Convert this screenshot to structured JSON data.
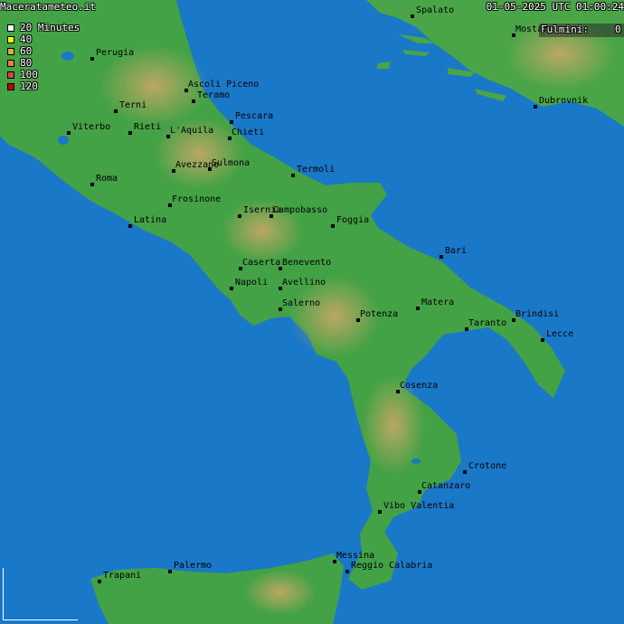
{
  "header": {
    "site": "Maceratameteo.it",
    "timestamp": "01-05-2025 UTC 01:00:24",
    "fulmini_label": "Fulmini:",
    "fulmini_count": "0"
  },
  "legend": [
    {
      "label": "20 Minutes",
      "color": "#ffffff"
    },
    {
      "label": "40",
      "color": "#ffff00"
    },
    {
      "label": "60",
      "color": "#e0b020"
    },
    {
      "label": "80",
      "color": "#e08040"
    },
    {
      "label": "100",
      "color": "#e04040"
    },
    {
      "label": "120",
      "color": "#c00000"
    }
  ],
  "cities": [
    {
      "name": "Spalato"
    },
    {
      "name": "Mostar"
    },
    {
      "name": "Dubrovnik"
    },
    {
      "name": "Perugia"
    },
    {
      "name": "Ascoli Piceno"
    },
    {
      "name": "Teramo"
    },
    {
      "name": "Terni"
    },
    {
      "name": "Pescara"
    },
    {
      "name": "Viterbo"
    },
    {
      "name": "Rieti"
    },
    {
      "name": "L'Aquila"
    },
    {
      "name": "Chieti"
    },
    {
      "name": "Sulmona"
    },
    {
      "name": "Avezzano"
    },
    {
      "name": "Termoli"
    },
    {
      "name": "Roma"
    },
    {
      "name": "Frosinone"
    },
    {
      "name": "Isernia"
    },
    {
      "name": "Campobasso"
    },
    {
      "name": "Foggia"
    },
    {
      "name": "Latina"
    },
    {
      "name": "Bari"
    },
    {
      "name": "Caserta"
    },
    {
      "name": "Benevento"
    },
    {
      "name": "Napoli"
    },
    {
      "name": "Avellino"
    },
    {
      "name": "Salerno"
    },
    {
      "name": "Matera"
    },
    {
      "name": "Brindisi"
    },
    {
      "name": "Potenza"
    },
    {
      "name": "Taranto"
    },
    {
      "name": "Lecce"
    },
    {
      "name": "Cosenza"
    },
    {
      "name": "Crotone"
    },
    {
      "name": "Catanzaro"
    },
    {
      "name": "Vibo Valentia"
    },
    {
      "name": "Messina"
    },
    {
      "name": "Palermo"
    },
    {
      "name": "Trapani"
    },
    {
      "name": "Reggio Calabria"
    }
  ],
  "colors": {
    "sea": "#1a78c8",
    "land": "#3fa043",
    "hills": "#b89a5a"
  }
}
